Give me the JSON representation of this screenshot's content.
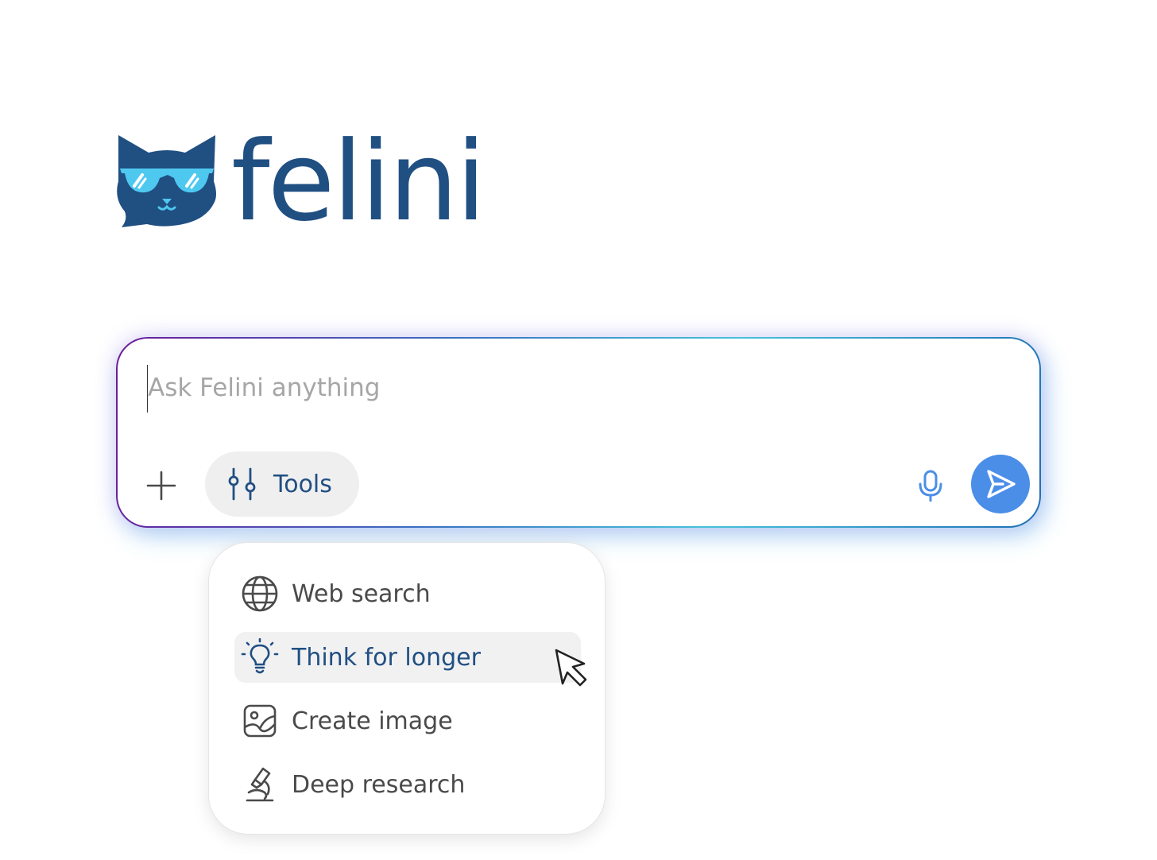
{
  "brand": {
    "name": "felini",
    "logo_icon": "cat-with-sunglasses-icon",
    "colors": {
      "primary": "#204f82",
      "lens": "#4fc8f0",
      "accent": "#4b8ee8"
    }
  },
  "composer": {
    "placeholder": "Ask Felini anything",
    "value": "",
    "add_icon": "plus-icon",
    "tools_button": {
      "label": "Tools",
      "icon": "sliders-icon"
    },
    "mic_icon": "microphone-icon",
    "send_icon": "send-icon"
  },
  "tools_menu": {
    "items": [
      {
        "label": "Web search",
        "icon": "globe-icon",
        "active": false
      },
      {
        "label": "Think for longer",
        "icon": "lightbulb-icon",
        "active": true
      },
      {
        "label": "Create image",
        "icon": "image-icon",
        "active": false
      },
      {
        "label": "Deep research",
        "icon": "microscope-icon",
        "active": false
      }
    ]
  },
  "cursor_icon": "arrow-cursor-icon"
}
